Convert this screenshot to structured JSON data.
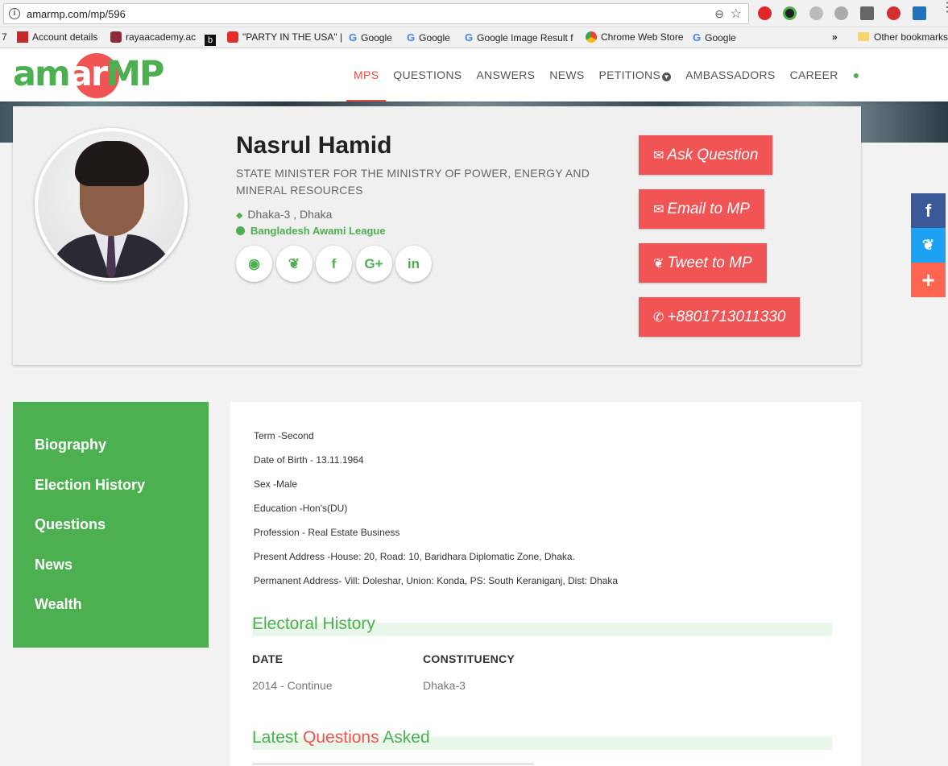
{
  "browser": {
    "url": "amarmp.com/mp/596",
    "bookmarks": [
      {
        "label": "7"
      },
      {
        "label": "Account details"
      },
      {
        "label": "rayaacademy.ac"
      },
      {
        "label": ""
      },
      {
        "label": "\"PARTY IN THE USA\" |"
      },
      {
        "label": "Google"
      },
      {
        "label": "Google"
      },
      {
        "label": "Google Image Result f"
      },
      {
        "label": "Chrome Web Store"
      },
      {
        "label": "Google"
      }
    ],
    "more": "»",
    "other_bookmarks": "Other bookmarks"
  },
  "logo": {
    "part1": "am",
    "part2": "ar",
    "part3": "MP"
  },
  "nav": {
    "items": [
      "MPS",
      "QUESTIONS",
      "ANSWERS",
      "NEWS",
      "PETITIONS",
      "AMBASSADORS",
      "CAREER"
    ],
    "active": "MPS"
  },
  "profile": {
    "name": "Nasrul Hamid",
    "title": "STATE MINISTER FOR THE MINISTRY OF POWER, ENERGY AND MINERAL RESOURCES",
    "location": "Dhaka-3 , Dhaka",
    "party": "Bangladesh Awami League"
  },
  "actions": {
    "ask": "Ask Question",
    "email": "Email to MP",
    "tweet": "Tweet to MP",
    "phone": "+8801713011330"
  },
  "sidebar": {
    "items": [
      "Biography",
      "Election History",
      "Questions",
      "News",
      "Wealth"
    ]
  },
  "bio": {
    "lines": [
      "Term -Second",
      "Date of Birth - 13.11.1964",
      "Sex -Male",
      "Education -Hon's(DU)",
      "Profession - Real Estate Business",
      "Present  Address -House: 20, Road: 10, Baridhara Diplomatic Zone, Dhaka.",
      "Permanent Address- Vill: Doleshar, Union: Konda, PS: South Keraniganj, Dist: Dhaka"
    ]
  },
  "electoral": {
    "heading": "Electoral History",
    "col_date": "DATE",
    "col_constituency": "CONSTITUENCY",
    "rows": [
      {
        "date": "2014 - Continue",
        "constituency": "Dhaka-3"
      }
    ]
  },
  "latest": {
    "part1": "Latest ",
    "part2": "Questions",
    "part3": " Asked"
  },
  "colors": {
    "green": "#4caf50",
    "red": "#f05455",
    "facebook": "#3b5998",
    "twitter": "#1da1f2",
    "plus": "#ff6550"
  }
}
